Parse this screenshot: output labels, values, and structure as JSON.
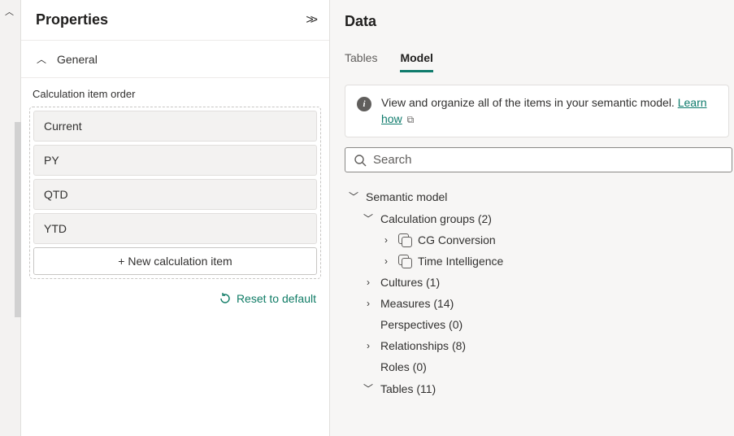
{
  "properties": {
    "title": "Properties",
    "section_general": "General",
    "calc_order_label": "Calculation item order",
    "items": [
      "Current",
      "PY",
      "QTD",
      "YTD"
    ],
    "new_item_label": "+ New calculation item",
    "reset_label": "Reset to default"
  },
  "data": {
    "title": "Data",
    "tabs": {
      "tables": "Tables",
      "model": "Model"
    },
    "active_tab": "Model",
    "info_text": "View and organize all of the items in your semantic model. ",
    "info_link": "Learn how",
    "search_placeholder": "Search",
    "tree": {
      "root": "Semantic model",
      "calc_groups_label": "Calculation groups (2)",
      "calc_groups": [
        "CG Conversion",
        "Time Intelligence"
      ],
      "cultures": "Cultures (1)",
      "measures": "Measures (14)",
      "perspectives": "Perspectives (0)",
      "relationships": "Relationships (8)",
      "roles": "Roles (0)",
      "tables": "Tables (11)"
    }
  }
}
